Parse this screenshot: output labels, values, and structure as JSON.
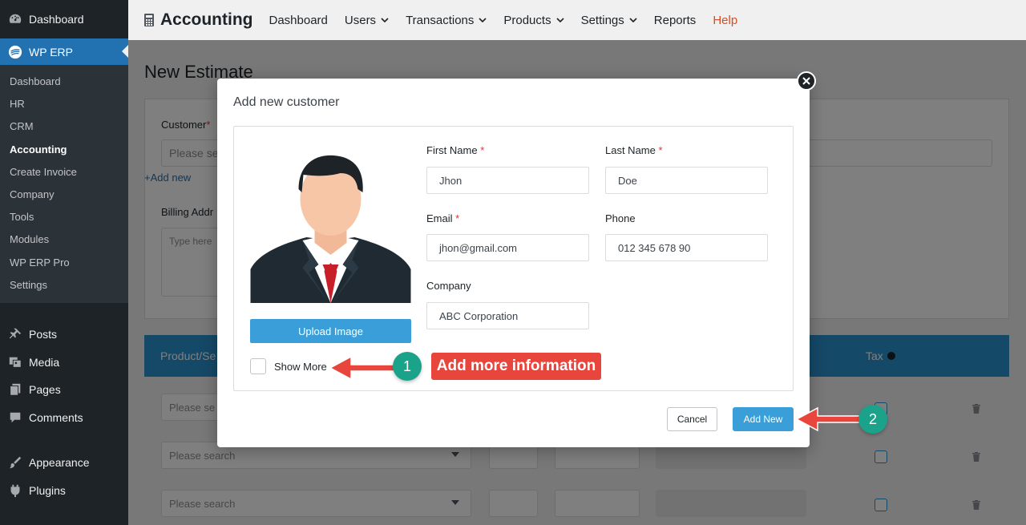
{
  "sidebar": {
    "dashboard": "Dashboard",
    "wp_erp": "WP ERP",
    "submenu": [
      "Dashboard",
      "HR",
      "CRM",
      "Accounting",
      "Create Invoice",
      "Company",
      "Tools",
      "Modules",
      "WP ERP Pro",
      "Settings"
    ],
    "menu_group1": [
      "Posts",
      "Media",
      "Pages",
      "Comments"
    ],
    "menu_group2": [
      "Appearance",
      "Plugins"
    ]
  },
  "topnav": {
    "title": "Accounting",
    "items": [
      "Dashboard",
      "Users",
      "Transactions",
      "Products",
      "Settings",
      "Reports",
      "Help"
    ]
  },
  "page": {
    "title": "New Estimate",
    "customer_label": "Customer",
    "customer_placeholder": "Please se",
    "add_new_link": "Add new",
    "billing_label": "Billing Addr",
    "billing_placeholder": "Type here",
    "col_product": "Product/Se",
    "col_tax": "Tax",
    "row_placeholder_1": "Please se",
    "row_placeholder_2": "Please search",
    "row_placeholder_3": "Please search"
  },
  "modal": {
    "title": "Add new customer",
    "upload_label": "Upload Image",
    "show_more_label": "Show More",
    "first_name_label": "First Name",
    "first_name_value": "Jhon",
    "last_name_label": "Last Name",
    "last_name_value": "Doe",
    "email_label": "Email",
    "email_value": "jhon@gmail.com",
    "phone_label": "Phone",
    "phone_value": "012 345 678 90",
    "company_label": "Company",
    "company_value": "ABC Corporation",
    "required_mark": "*",
    "cancel_label": "Cancel",
    "add_new_label": "Add New"
  },
  "annotations": {
    "badge1": "1",
    "badge2": "2",
    "callout": "Add more information",
    "arrow_color": "#e8453c",
    "badge_color": "#1aa38a"
  }
}
